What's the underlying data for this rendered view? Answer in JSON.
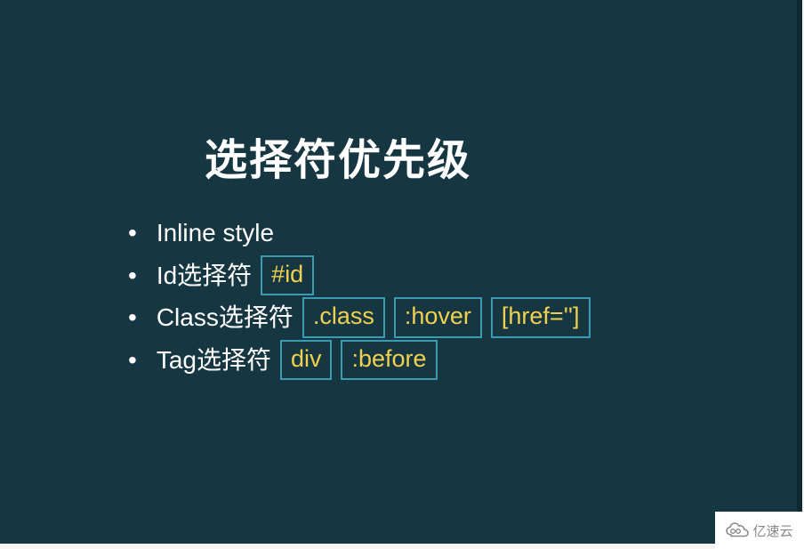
{
  "slide": {
    "title": "选择符优先级",
    "items": [
      {
        "label": "Inline style",
        "codes": []
      },
      {
        "label": "Id选择符",
        "codes": [
          "#id"
        ]
      },
      {
        "label": "Class选择符",
        "codes": [
          ".class",
          ":hover",
          "[href='']"
        ]
      },
      {
        "label": "Tag选择符",
        "codes": [
          "div",
          ":before"
        ]
      }
    ]
  },
  "watermark": {
    "text": "亿速云"
  }
}
